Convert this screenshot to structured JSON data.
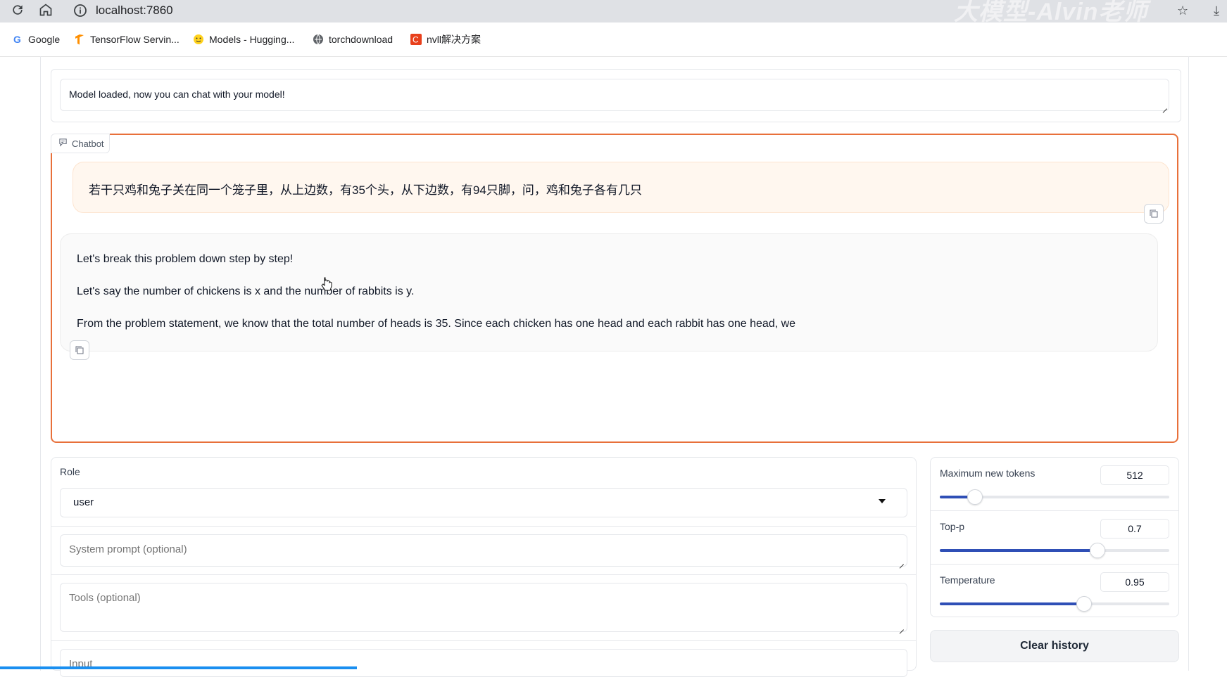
{
  "browser": {
    "url": "localhost:7860",
    "watermark": "大模型-Alvin老师",
    "bookmarks": [
      {
        "label": "Google",
        "icon": "google-g-icon"
      },
      {
        "label": "TensorFlow Servin...",
        "icon": "tensorflow-icon"
      },
      {
        "label": "Models - Hugging...",
        "icon": "huggingface-icon"
      },
      {
        "label": "torchdownload",
        "icon": "globe-icon"
      },
      {
        "label": "nvll解决方案",
        "icon": "csdn-icon"
      }
    ]
  },
  "status": {
    "message": "Model loaded, now you can chat with your model!"
  },
  "chatbot": {
    "label": "Chatbot",
    "user_message": "若干只鸡和兔子关在同一个笼子里，从上边数，有35个头，从下边数，有94只脚，问，鸡和兔子各有几只",
    "bot_lines": [
      "Let's break this problem down step by step!",
      "Let's say the number of chickens is x and the number of rabbits is y.",
      "From the problem statement, we know that the total number of heads is 35. Since each chicken has one head and each rabbit has one head, we"
    ]
  },
  "controls": {
    "role_label": "Role",
    "role_value": "user",
    "system_prompt_placeholder": "System prompt (optional)",
    "tools_placeholder": "Tools (optional)",
    "input_placeholder": "Input",
    "clear_label": "Clear history",
    "sliders": [
      {
        "label": "Maximum new tokens",
        "value": "512",
        "fraction": 0.15
      },
      {
        "label": "Top-p",
        "value": "0.7",
        "fraction": 0.685
      },
      {
        "label": "Temperature",
        "value": "0.95",
        "fraction": 0.625
      }
    ]
  },
  "colors": {
    "accent": "#e8703a",
    "slider_fill": "#2f4fb6",
    "user_bubble": "#fff7ef"
  }
}
